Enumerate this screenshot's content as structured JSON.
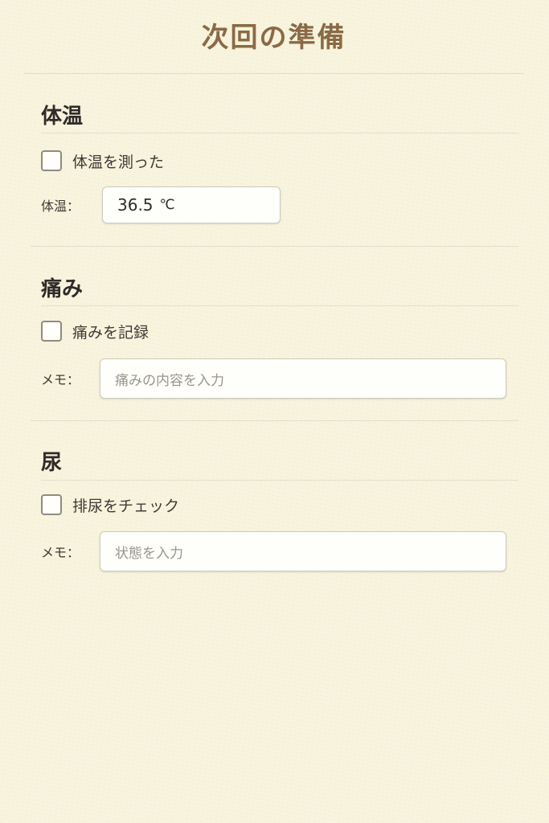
{
  "header": {
    "title": "次回の準備"
  },
  "sections": [
    {
      "title": "体温",
      "checkbox_label": "体温を測った",
      "checked": false,
      "field_label": "体温：",
      "value": "36.5",
      "unit": "℃"
    },
    {
      "title": "痛み",
      "checkbox_label": "痛みを記録",
      "checked": false,
      "field_label": "メモ：",
      "placeholder": "痛みの内容を入力"
    },
    {
      "title": "尿",
      "checkbox_label": "排尿をチェック",
      "checked": false,
      "field_label": "メモ：",
      "placeholder": "状態を入力"
    }
  ],
  "colors": {
    "background": "#f7f3dd",
    "title": "#8a6a46",
    "text": "#3a3632"
  }
}
